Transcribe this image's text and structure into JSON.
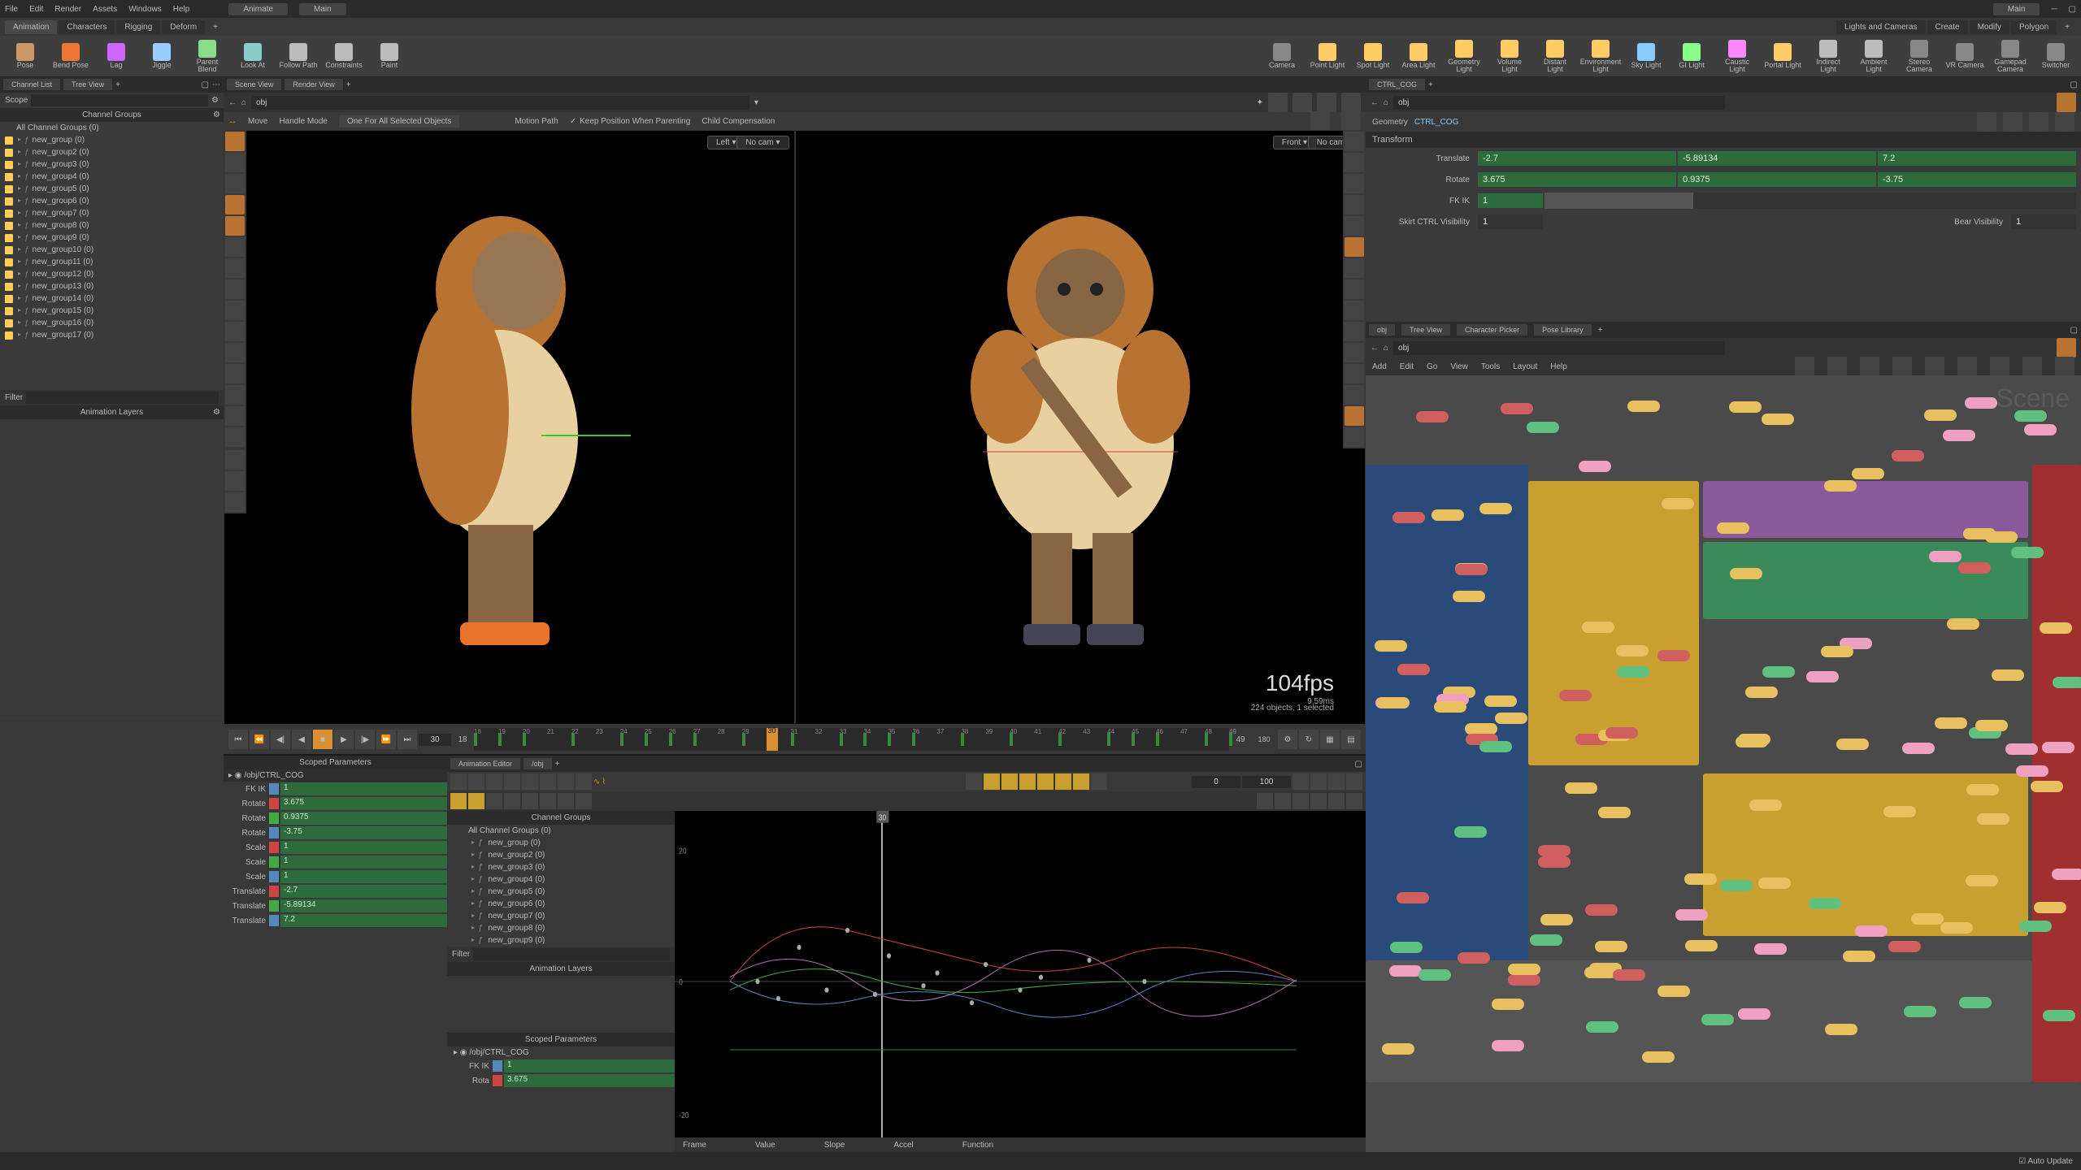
{
  "menu": [
    "File",
    "Edit",
    "Render",
    "Assets",
    "Windows",
    "Help"
  ],
  "desktops": [
    "Animate",
    "Main"
  ],
  "right_desktop": "Main",
  "shelf_tabs": [
    "Animation",
    "Characters",
    "Rigging",
    "Deform"
  ],
  "shelf_left": [
    {
      "label": "Pose",
      "color": "#c96"
    },
    {
      "label": "Bend Pose",
      "color": "#e73"
    },
    {
      "label": "Lag",
      "color": "#c6f"
    },
    {
      "label": "Jiggle",
      "color": "#9cf"
    },
    {
      "label": "Parent Blend",
      "color": "#8d8"
    },
    {
      "label": "Look At",
      "color": "#8cc"
    },
    {
      "label": "Follow Path",
      "color": "#bbb"
    },
    {
      "label": "Constraints",
      "color": "#bbb"
    },
    {
      "label": "Paint",
      "color": "#bbb"
    }
  ],
  "shelf_right": [
    {
      "label": "Camera",
      "color": "#888"
    },
    {
      "label": "Point Light",
      "color": "#fc6"
    },
    {
      "label": "Spot Light",
      "color": "#fc6"
    },
    {
      "label": "Area Light",
      "color": "#fc6"
    },
    {
      "label": "Geometry Light",
      "color": "#fc6"
    },
    {
      "label": "Volume Light",
      "color": "#fc6"
    },
    {
      "label": "Distant Light",
      "color": "#fc6"
    },
    {
      "label": "Environment Light",
      "color": "#fc6"
    },
    {
      "label": "Sky Light",
      "color": "#8cf"
    },
    {
      "label": "GI Light",
      "color": "#8f8"
    },
    {
      "label": "Caustic Light",
      "color": "#f8f"
    },
    {
      "label": "Portal Light",
      "color": "#fc6"
    },
    {
      "label": "Indirect Light",
      "color": "#bbb"
    },
    {
      "label": "Ambient Light",
      "color": "#bbb"
    },
    {
      "label": "Stereo Camera",
      "color": "#888"
    },
    {
      "label": "VR Camera",
      "color": "#888"
    },
    {
      "label": "Gamepad Camera",
      "color": "#888"
    },
    {
      "label": "Switcher",
      "color": "#888"
    }
  ],
  "left_tabs": [
    "Channel List",
    "Tree View"
  ],
  "scope_label": "Scope",
  "channel_groups_title": "Channel Groups",
  "channel_groups_root": "All Channel Groups (0)",
  "channel_groups": [
    "new_group (0)",
    "new_group2 (0)",
    "new_group3 (0)",
    "new_group4 (0)",
    "new_group5 (0)",
    "new_group6 (0)",
    "new_group7 (0)",
    "new_group8 (0)",
    "new_group9 (0)",
    "new_group10 (0)",
    "new_group11 (0)",
    "new_group12 (0)",
    "new_group13 (0)",
    "new_group14 (0)",
    "new_group15 (0)",
    "new_group16 (0)",
    "new_group17 (0)"
  ],
  "filter_label": "Filter",
  "anim_layers_title": "Animation Layers",
  "scoped_title": "Scoped Parameters",
  "scoped_node": "/obj/CTRL_COG",
  "scoped_params": [
    {
      "name": "FK IK",
      "swatch": "#58b",
      "value": "1"
    },
    {
      "name": "Rotate",
      "swatch": "#c44",
      "value": "3.675"
    },
    {
      "name": "Rotate",
      "swatch": "#4a4",
      "value": "0.9375"
    },
    {
      "name": "Rotate",
      "swatch": "#58b",
      "value": "-3.75"
    },
    {
      "name": "Scale",
      "swatch": "#c44",
      "value": "1"
    },
    {
      "name": "Scale",
      "swatch": "#4a4",
      "value": "1"
    },
    {
      "name": "Scale",
      "swatch": "#58b",
      "value": "1"
    },
    {
      "name": "Translate",
      "swatch": "#c44",
      "value": "-2.7"
    },
    {
      "name": "Translate",
      "swatch": "#4a4",
      "value": "-5.89134"
    },
    {
      "name": "Translate",
      "swatch": "#58b",
      "value": "7.2"
    }
  ],
  "scene_tabs": [
    "Scene View",
    "Render View"
  ],
  "obj_path": "obj",
  "move_label": "Move",
  "handle_mode": "Handle Mode",
  "one_for_all": "One For All Selected Objects",
  "motion_path": "Motion Path",
  "keep_pos": "Keep Position When Parenting",
  "child_comp": "Child Compensation",
  "vp_left_label": "Left",
  "vp_front_label": "Front",
  "vp_nocam": "No cam",
  "fps": "104fps",
  "fps_ms": "9.59ms",
  "stats": "224 objects, 1 selected",
  "timeline": {
    "start": 18,
    "end": 49,
    "end2": 180,
    "current": 30,
    "current_box": "30"
  },
  "ae_tab": "Animation Editor",
  "ae_path": "/obj",
  "ae_range_start": "0",
  "ae_range_end": "100",
  "ae_tree_title": "Channel Groups",
  "ae_tree_root": "All Channel Groups (0)",
  "ae_groups": [
    "new_group (0)",
    "new_group2 (0)",
    "new_group3 (0)",
    "new_group4 (0)",
    "new_group5 (0)",
    "new_group6 (0)",
    "new_group7 (0)",
    "new_group8 (0)",
    "new_group9 (0)"
  ],
  "ae_anim_layers": "Animation Layers",
  "ae_scoped": "Scoped Parameters",
  "ae_scoped_node": "/obj/CTRL_COG",
  "ae_scoped_params": [
    {
      "name": "FK IK",
      "value": "1"
    },
    {
      "name": "Rota",
      "value": "3.675"
    }
  ],
  "graph_status": [
    "Frame",
    "Value",
    "Slope",
    "Accel",
    "Function"
  ],
  "graph_y": [
    "20",
    "0",
    "-20"
  ],
  "ctrl_tab": "CTRL_COG",
  "geom_label": "Geometry",
  "geom_node": "CTRL_COG",
  "transform_label": "Transform",
  "params": {
    "Translate": {
      "x": "-2.7",
      "y": "-5.89134",
      "z": "7.2"
    },
    "Rotate": {
      "x": "3.675",
      "y": "0.9375",
      "z": "-3.75"
    },
    "fkik_label": "FK IK",
    "fkik": "1",
    "skirt_label": "Skirt CTRL Visibility",
    "skirt": "1",
    "bear_label": "Bear Visibility",
    "bear": "1"
  },
  "net_tabs": [
    "obj",
    "Tree View",
    "Character Picker",
    "Pose Library"
  ],
  "net_menu": [
    "Add",
    "Edit",
    "Go",
    "View",
    "Tools",
    "Layout",
    "Help"
  ],
  "net_path": "obj",
  "net_watermark": "Scene",
  "status": {
    "auto_update": "Auto Update"
  }
}
